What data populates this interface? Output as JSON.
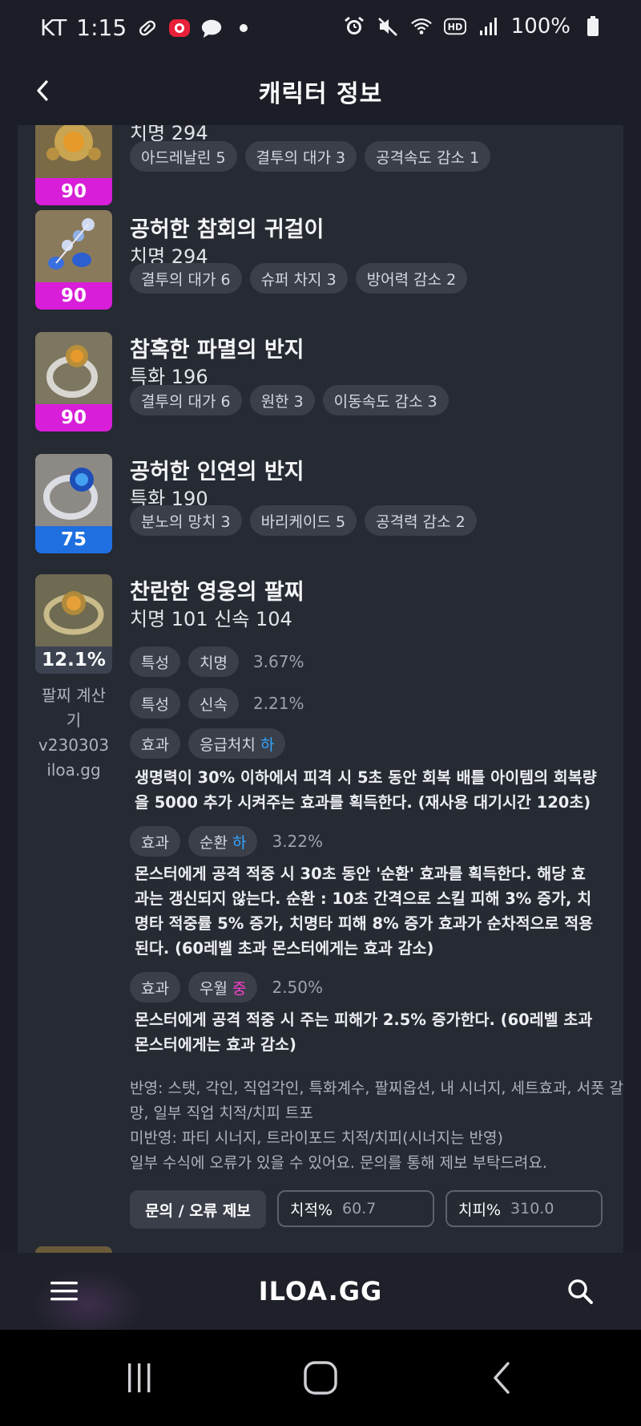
{
  "status_bar": {
    "carrier": "KT",
    "time": "1:15",
    "battery": "100%",
    "left_icons": [
      "pill-icon",
      "red-app-icon",
      "chat-bubble-icon",
      "dot-icon"
    ],
    "right_icons": [
      "alarm-icon",
      "mute-icon",
      "wifi-icon",
      "hd-icon",
      "signal-icon",
      "battery-icon"
    ]
  },
  "header": {
    "title": "캐릭터 정보",
    "back_icon": "chevron-left-icon"
  },
  "items": [
    {
      "badge": "90",
      "badge_color": "#d81ed8",
      "stat": "치명 294",
      "engravings": [
        "아드레날린 5",
        "결투의 대가 3",
        "공격속도 감소 1"
      ]
    },
    {
      "name": "공허한 참회의 귀걸이",
      "badge": "90",
      "badge_color": "#d81ed8",
      "stat": "치명 294",
      "engravings": [
        "결투의 대가 6",
        "슈퍼 차지 3",
        "방어력 감소 2"
      ]
    },
    {
      "name": "참혹한 파멸의 반지",
      "badge": "90",
      "badge_color": "#d81ed8",
      "stat": "특화 196",
      "engravings": [
        "결투의 대가 6",
        "원한 3",
        "이동속도 감소 3"
      ]
    },
    {
      "name": "공허한 인연의 반지",
      "badge": "75",
      "badge_color": "#1f6fe0",
      "stat": "특화 190",
      "engravings": [
        "분노의 망치 3",
        "바리케이드 5",
        "공격력 감소 2"
      ]
    }
  ],
  "bracelet": {
    "name": "찬란한 영웅의 팔찌",
    "stat": "치명 101  신속 104",
    "badge": "12.1%",
    "side_text": [
      "팔찌 계산기",
      "v230303",
      "iloa.gg"
    ],
    "options": [
      {
        "type": "특성",
        "name": "치명",
        "pct": "3.67%"
      },
      {
        "type": "특성",
        "name": "신속",
        "pct": "2.21%"
      },
      {
        "type": "효과",
        "name": "응급처치",
        "grade": "하",
        "grade_color": "#33a6ff",
        "pct": "",
        "desc": "생명력이 30% 이하에서 피격 시 5초 동안 회복 배틀 아이템의 회복량을 5000 추가 시켜주는 효과를 획득한다. (재사용 대기시간 120초)"
      },
      {
        "type": "효과",
        "name": "순환",
        "grade": "하",
        "grade_color": "#33a6ff",
        "pct": "3.22%",
        "desc": "몬스터에게 공격 적중 시 30초 동안 '순환' 효과를 획득한다. 해당 효과는 갱신되지 않는다. 순환 : 10초 간격으로 스킬 피해 3% 증가, 치명타 적중률 5% 증가, 치명타 피해 8% 증가 효과가 순차적으로 적용된다. (60레벨 초과 몬스터에게는 효과 감소)"
      },
      {
        "type": "효과",
        "name": "우월",
        "grade": "중",
        "grade_color": "#ff3fd0",
        "pct": "2.50%",
        "desc": "몬스터에게 공격 적중 시 주는 피해가 2.5% 증가한다. (60레벨 초과 몬스터에게는 효과 감소)"
      }
    ],
    "notes": [
      "반영: 스탯, 각인, 직업각인, 특화계수, 팔찌옵션, 내 시너지, 세트효과, 서폿 갈망, 일부 직업 치적/치피 트포",
      "미반영: 파티 시너지, 트라이포드 치적/치피(시너지는 반영)",
      "일부 수식에 오류가 있을 수 있어요. 문의를 통해 제보 부탁드려요."
    ],
    "report_label": "문의 / 오류 제보",
    "crit_rate_label": "치적%",
    "crit_rate_value": "60.7",
    "crit_dmg_label": "치피%",
    "crit_dmg_value": "310.0"
  },
  "bottom_bar": {
    "brand": "ILOA.GG",
    "menu_icon": "hamburger-menu-icon",
    "search_icon": "search-icon"
  },
  "nav_bar": {
    "icons": [
      "recent-apps-icon",
      "home-icon",
      "back-icon"
    ]
  }
}
